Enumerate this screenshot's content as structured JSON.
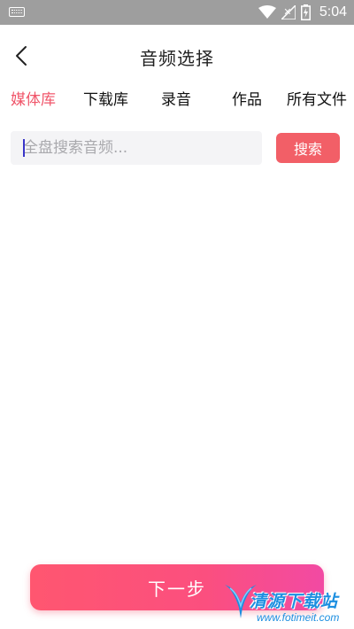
{
  "status_bar": {
    "time": "5:04",
    "icons": [
      "keyboard-icon",
      "wifi-icon",
      "signal-icon",
      "battery-charging-icon"
    ]
  },
  "header": {
    "back_icon": "chevron-left-icon",
    "title": "音频选择"
  },
  "tabs": [
    {
      "label": "媒体库",
      "active": true
    },
    {
      "label": "下载库",
      "active": false
    },
    {
      "label": "录音",
      "active": false
    },
    {
      "label": "作品",
      "active": false
    },
    {
      "label": "所有文件",
      "active": false
    }
  ],
  "search": {
    "placeholder": "全盘搜索音频...",
    "value": "",
    "button_label": "搜索"
  },
  "footer": {
    "next_label": "下一步"
  },
  "watermark": {
    "name": "清源下载站",
    "url": "www.fotimeit.com"
  },
  "colors": {
    "accent": "#f0566a",
    "search_button": "#f25f67",
    "status_bar": "#9e9e9e",
    "gradient_start": "#ff5670",
    "gradient_end": "#f24aa3"
  }
}
